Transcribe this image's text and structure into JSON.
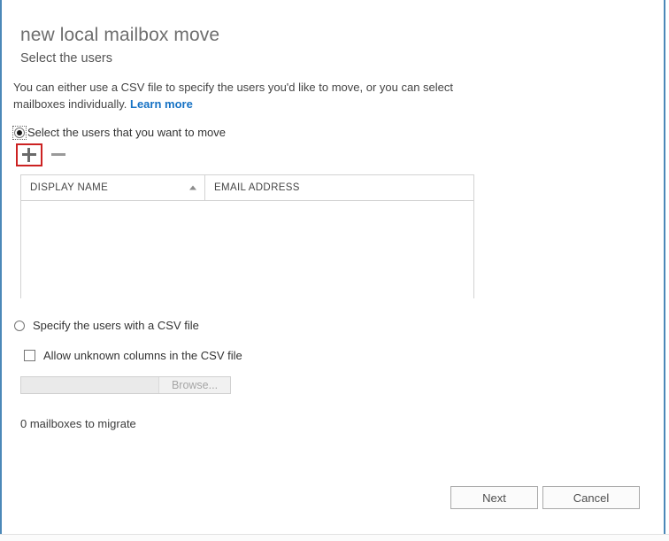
{
  "dialog": {
    "title": "new local mailbox move",
    "subtitle": "Select the users",
    "description_before": "You can either use a CSV file to specify the users you'd like to move, or you can select mailboxes individually. ",
    "learn_more_label": "Learn more"
  },
  "options": {
    "select_users": {
      "label": "Select the users that you want to move",
      "checked": true,
      "focused": true
    },
    "specify_csv": {
      "label": "Specify the users with a CSV file",
      "checked": false,
      "focused": false
    }
  },
  "toolbar": {
    "add_label": "+",
    "remove_label": "–",
    "add_icon": "plus-icon",
    "remove_icon": "minus-icon",
    "add_highlight_color": "#cc2222"
  },
  "grid": {
    "columns": [
      {
        "label": "DISPLAY NAME",
        "sorted": true,
        "sort_direction": "asc"
      },
      {
        "label": "EMAIL ADDRESS",
        "sorted": false,
        "sort_direction": ""
      }
    ],
    "rows": []
  },
  "csv": {
    "allow_unknown_columns_label": "Allow unknown columns in the CSV file",
    "allow_unknown_columns_checked": false,
    "file_path_value": "",
    "browse_label": "Browse...",
    "disabled": true
  },
  "status": {
    "text": "0 mailboxes to migrate"
  },
  "footer": {
    "next_label": "Next",
    "cancel_label": "Cancel"
  },
  "colors": {
    "accent_border": "#4b88b8",
    "link": "#1672c4",
    "highlight": "#cc2222"
  }
}
